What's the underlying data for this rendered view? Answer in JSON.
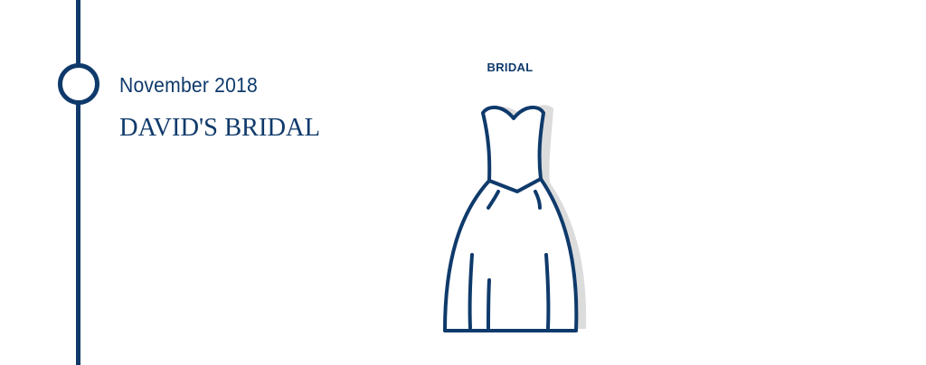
{
  "timeline": {
    "date": "November 2018",
    "brand": "DAVID'S BRIDAL",
    "category": "BRIDAL"
  },
  "icons": {
    "node": "timeline-node-circle",
    "dress": "wedding-dress-icon"
  },
  "colors": {
    "primary": "#0f3a6b",
    "shadow": "#dcdcdc",
    "highlight": "#e4eff7"
  }
}
